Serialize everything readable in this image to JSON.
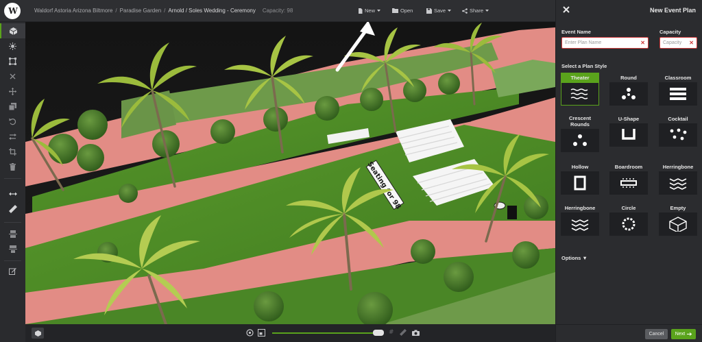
{
  "breadcrumb": {
    "venue": "Waldorf Astoria Arizona Biltmore",
    "space": "Paradise Garden",
    "event": "Arnold / Soles Wedding - Ceremony",
    "capacity": "Capacity: 98"
  },
  "toolbar": {
    "new_label": "New",
    "open_label": "Open",
    "save_label": "Save",
    "share_label": "Share"
  },
  "sidebar": {
    "tools": [
      "cube-view",
      "sun-light",
      "select-frame",
      "close",
      "move",
      "copy",
      "undo",
      "swap",
      "crop",
      "delete",
      "measure",
      "ruler",
      "align-distribute",
      "align-stack",
      "edit-note"
    ]
  },
  "scene": {
    "seating_label": "Seating for 98"
  },
  "panel": {
    "title": "New Event Plan",
    "event_name_label": "Event Name",
    "event_name_placeholder": "Enter Plan Name",
    "capacity_label": "Capacity",
    "capacity_placeholder": "Capacity",
    "select_style_label": "Select a Plan Style",
    "styles": [
      {
        "name": "Theater",
        "icon": "theater-icon",
        "selected": true
      },
      {
        "name": "Round",
        "icon": "round-icon"
      },
      {
        "name": "Classroom",
        "icon": "classroom-icon"
      },
      {
        "name": "Crescent Rounds",
        "icon": "crescent-rounds-icon"
      },
      {
        "name": "U-Shape",
        "icon": "u-shape-icon"
      },
      {
        "name": "Cocktail",
        "icon": "cocktail-icon"
      },
      {
        "name": "Hollow",
        "icon": "hollow-icon"
      },
      {
        "name": "Boardroom",
        "icon": "boardroom-icon"
      },
      {
        "name": "Herringbone",
        "icon": "herringbone-icon"
      },
      {
        "name": "Herringbone",
        "icon": "herringbone-icon"
      },
      {
        "name": "Circle",
        "icon": "circle-icon"
      },
      {
        "name": "Empty",
        "icon": "empty-cube-icon"
      }
    ],
    "options_label": "Options ▼",
    "cancel_label": "Cancel",
    "next_label": "Next"
  },
  "colors": {
    "accent": "#5aa31c",
    "error": "#d03a3a",
    "path": "#e8918a",
    "lawn": "#4f8a27"
  },
  "zoom": {
    "level": 0.97
  }
}
